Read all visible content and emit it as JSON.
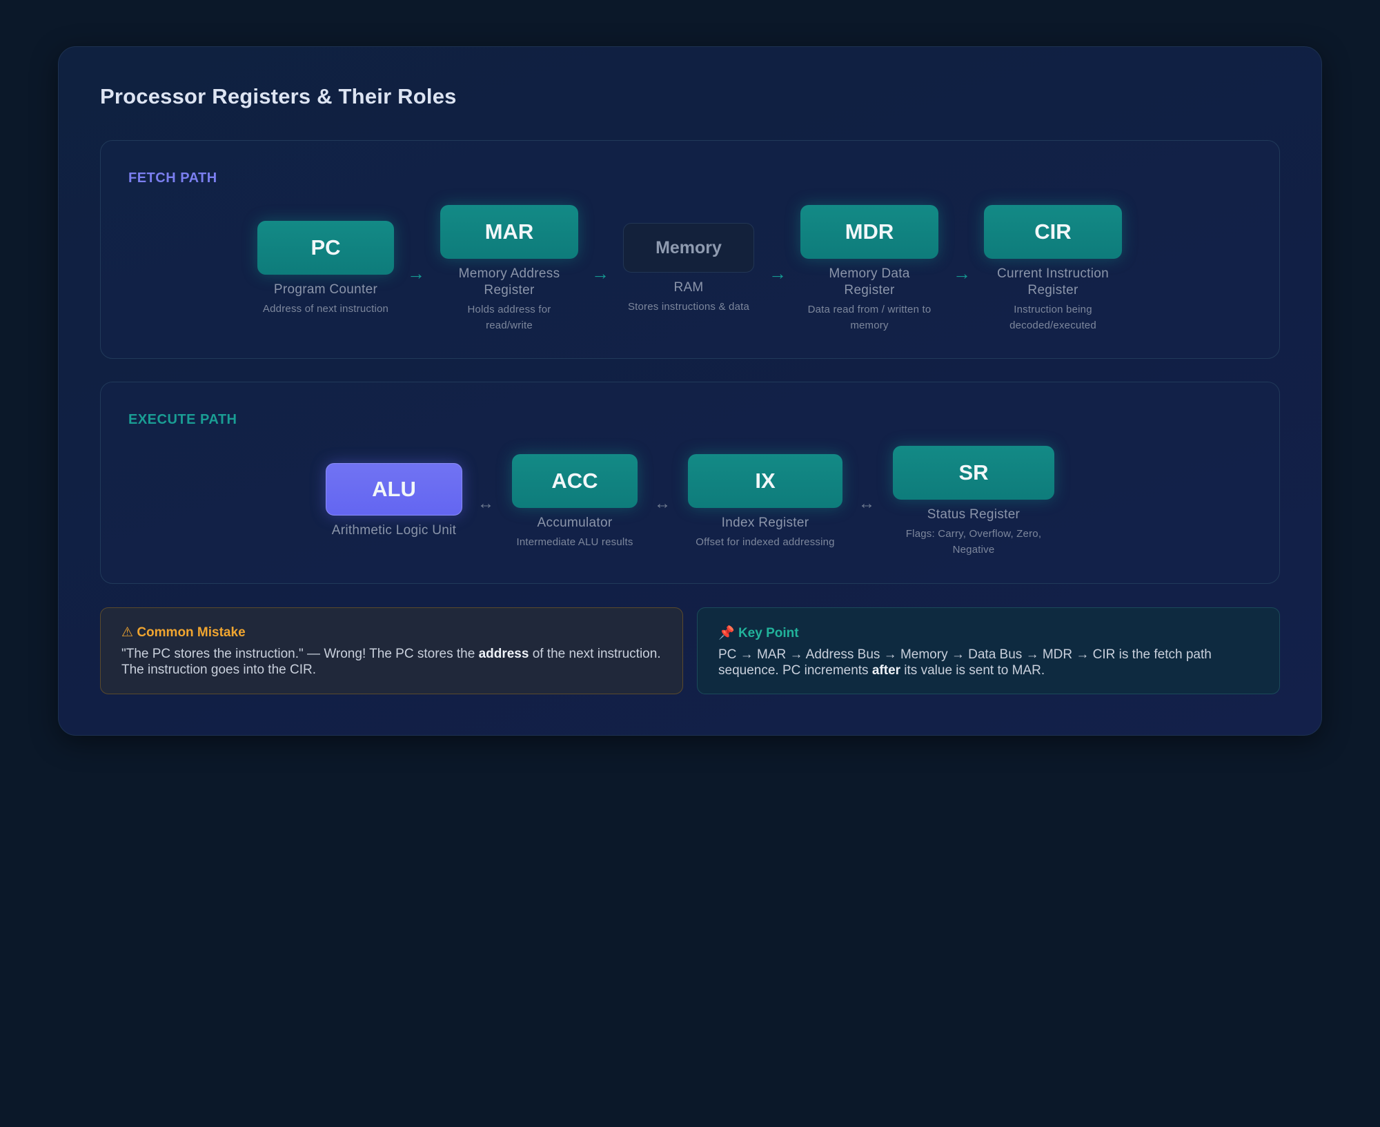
{
  "title": "Processor Registers & Their Roles",
  "fetch": {
    "label": "FETCH PATH",
    "arrow": "→",
    "nodes": [
      {
        "abbr": "PC",
        "name": "Program Counter",
        "desc": "Address of next instruction"
      },
      {
        "abbr": "MAR",
        "name": "Memory Address Register",
        "desc": "Holds address for read/write"
      },
      {
        "abbr": "Memory",
        "name": "RAM",
        "desc": "Stores instructions & data"
      },
      {
        "abbr": "MDR",
        "name": "Memory Data Register",
        "desc": "Data read from / written to memory"
      },
      {
        "abbr": "CIR",
        "name": "Current Instruction Register",
        "desc": "Instruction being decoded/executed"
      }
    ]
  },
  "execute": {
    "label": "EXECUTE PATH",
    "arrow": "↔",
    "nodes": [
      {
        "abbr": "ALU",
        "name": "Arithmetic Logic Unit"
      },
      {
        "abbr": "ACC",
        "name": "Accumulator",
        "desc": "Intermediate ALU results"
      },
      {
        "abbr": "IX",
        "name": "Index Register",
        "desc": "Offset for indexed addressing"
      },
      {
        "abbr": "SR",
        "name": "Status Register",
        "desc": "Flags: Carry, Overflow, Zero, Negative"
      }
    ]
  },
  "notes": {
    "mistake": {
      "icon": "⚠",
      "heading": "Common Mistake",
      "before": "\"The PC stores the instruction.\" — Wrong! The PC stores the ",
      "bold": "address",
      "after": " of the next instruction. The instruction goes into the CIR."
    },
    "key": {
      "icon": "📌",
      "heading": "Key Point",
      "before": "PC → MAR → Address Bus → Memory → Data Bus → MDR → CIR is the fetch path sequence. PC increments ",
      "bold": "after",
      "after": " its value is sent to MAR."
    }
  },
  "colors": {
    "background": "#0b1829",
    "register": "#0e7c7b",
    "alu": "#6366f1",
    "fetch_label": "#7b7ff0",
    "execute_label": "#1a9e94",
    "warning": "#f0a530",
    "key": "#22b39b"
  }
}
